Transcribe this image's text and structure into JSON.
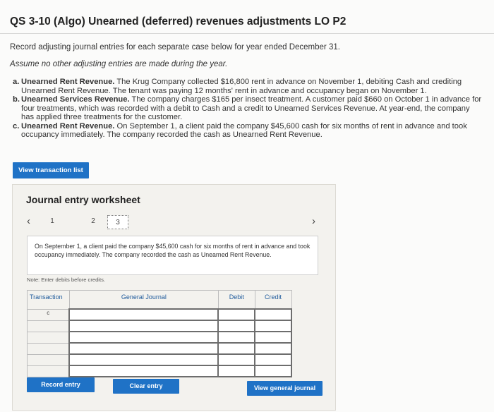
{
  "page_title": "QS 3-10 (Algo) Unearned (deferred) revenues adjustments LO P2",
  "instructions": "Record adjusting journal entries for each separate case below for year ended December 31.",
  "assumption": "Assume no other adjusting entries are made during the year.",
  "cases": [
    {
      "letter": "a.",
      "bold": "Unearned Rent Revenue.",
      "text": " The Krug Company collected $16,800 rent in advance on November 1, debiting Cash and crediting Unearned Rent Revenue. The tenant was paying 12 months' rent in advance and occupancy began on November 1."
    },
    {
      "letter": "b.",
      "bold": "Unearned Services Revenue.",
      "text": " The company charges $165 per insect treatment. A customer paid $660 on October 1 in advance for four treatments, which was recorded with a debit to Cash and a credit to Unearned Services Revenue. At year-end, the company has applied three treatments for the customer."
    },
    {
      "letter": "c.",
      "bold": "Unearned Rent Revenue.",
      "text": " On September 1, a client paid the company $45,600 cash for six months of rent in advance and took occupancy immediately. The company recorded the cash as Unearned Rent Revenue."
    }
  ],
  "view_transaction_list": "View transaction list",
  "worksheet": {
    "title": "Journal entry worksheet",
    "pages": [
      "1",
      "2",
      "3"
    ],
    "active_page": "3",
    "prev_icon": "chevron-left-icon",
    "next_icon": "chevron-right-icon",
    "description": "On September 1, a client paid the company $45,600 cash for six months of rent in advance and took occupancy immediately. The company recorded the cash as Unearned Rent Revenue.",
    "note": "Note: Enter debits before credits.",
    "columns": {
      "transaction": "Transaction",
      "general_journal": "General Journal",
      "debit": "Debit",
      "credit": "Credit"
    },
    "transaction_label": "c",
    "row_count": 6,
    "record_entry": "Record entry",
    "clear_entry": "Clear entry",
    "view_general_journal": "View general journal"
  },
  "colors": {
    "accent": "#1f72c6",
    "header_text": "#1e5a9c"
  }
}
